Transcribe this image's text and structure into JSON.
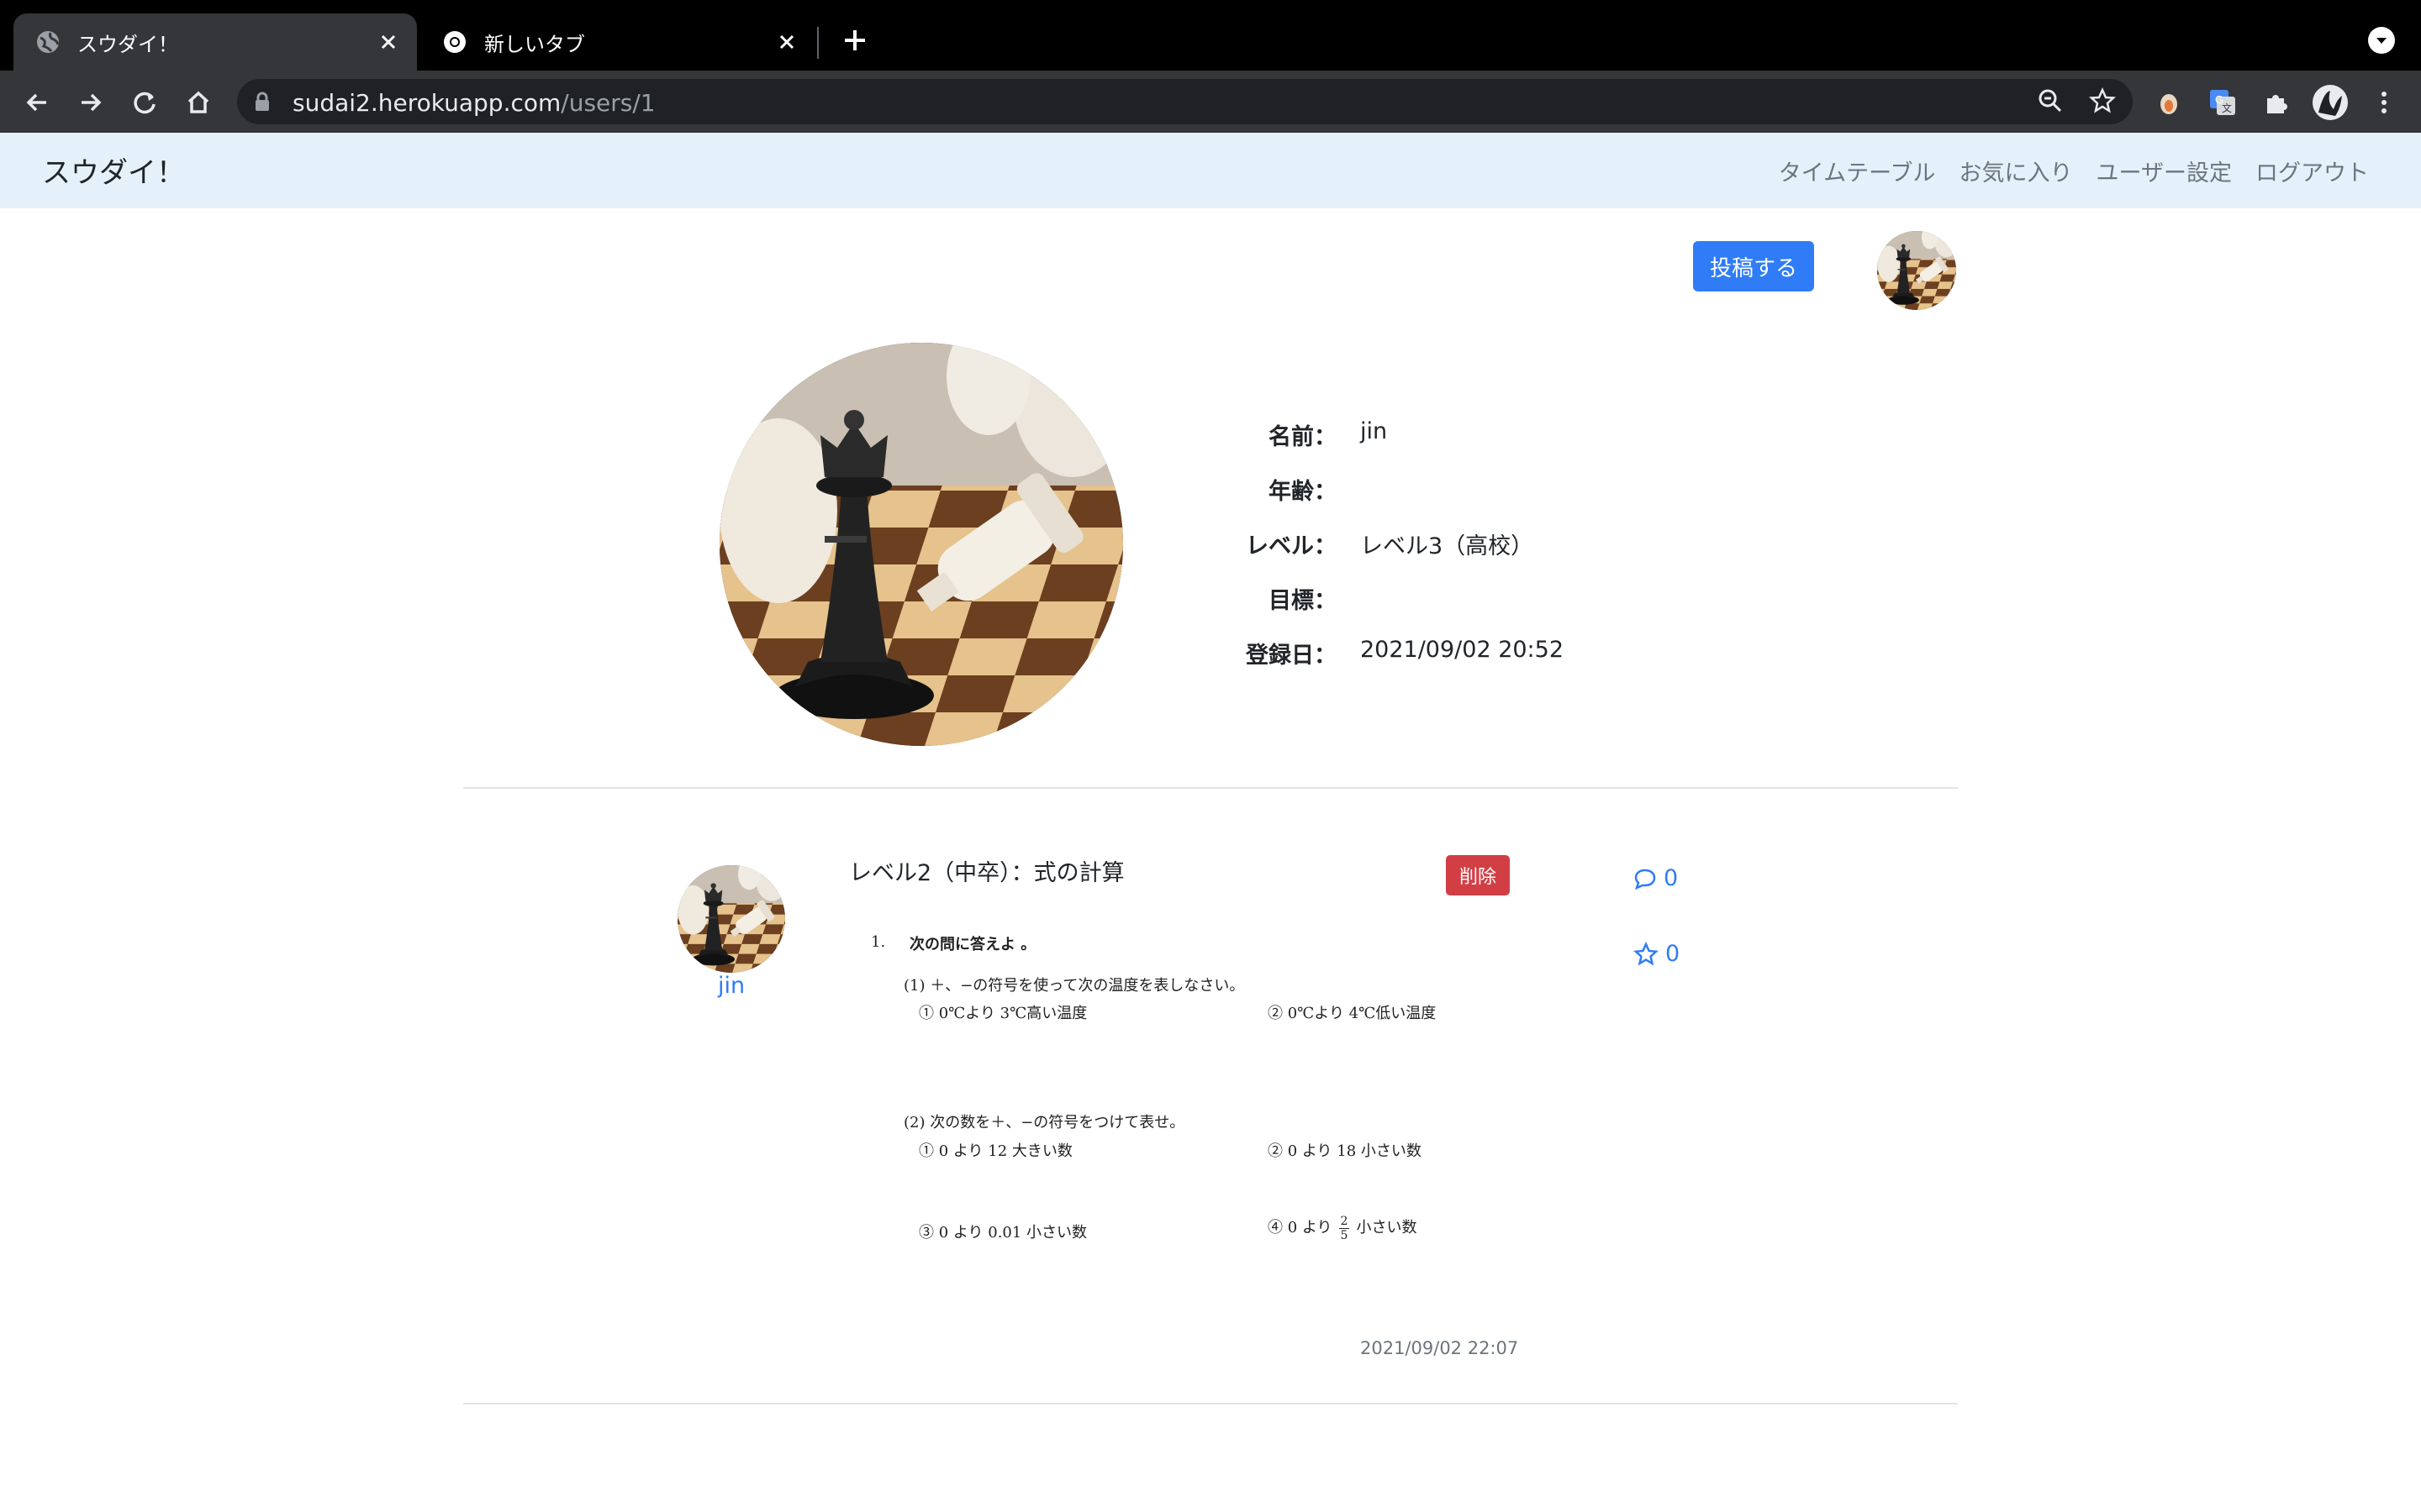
{
  "browser": {
    "tabs": [
      {
        "title": "スウダイ！",
        "active": true
      },
      {
        "title": "新しいタブ",
        "active": false
      }
    ],
    "url_host": "sudai2.herokuapp.com",
    "url_path": "/users/1"
  },
  "site": {
    "brand": "スウダイ！",
    "nav": [
      "タイムテーブル",
      "お気に入り",
      "ユーザー設定",
      "ログアウト"
    ]
  },
  "actions": {
    "post_button": "投稿する"
  },
  "profile": {
    "fields": [
      {
        "label": "名前：",
        "value": "jin"
      },
      {
        "label": "年齢：",
        "value": ""
      },
      {
        "label": "レベル：",
        "value": "レベル3（高校）"
      },
      {
        "label": "目標：",
        "value": ""
      },
      {
        "label": "登録日：",
        "value": "2021/09/02 20:52"
      }
    ]
  },
  "post": {
    "user": "jin",
    "title": "レベル2（中卒）：式の計算",
    "delete_label": "削除",
    "comments": "0",
    "favorites": "0",
    "date": "2021/09/02 22:07",
    "problem": {
      "num": "1.",
      "heading": "次の問に答えよ 。",
      "q1": "(1) ＋、−の符号を使って次の温度を表しなさい。",
      "q1a": "① 0℃より 3℃高い温度",
      "q1b": "② 0℃より 4℃低い温度",
      "q2": "(2) 次の数を＋、−の符号をつけて表せ。",
      "q2a": "① 0 より 12 大きい数",
      "q2b": "② 0 より 18 小さい数",
      "q2c": "③ 0 より 0.01 小さい数",
      "q2d_pre": "④ 0 より",
      "q2d_num": "2",
      "q2d_den": "5",
      "q2d_post": "小さい数"
    }
  },
  "colors": {
    "accent": "#2f7cf6",
    "danger": "#d13f45",
    "navbar_bg": "#e4f1fa"
  }
}
